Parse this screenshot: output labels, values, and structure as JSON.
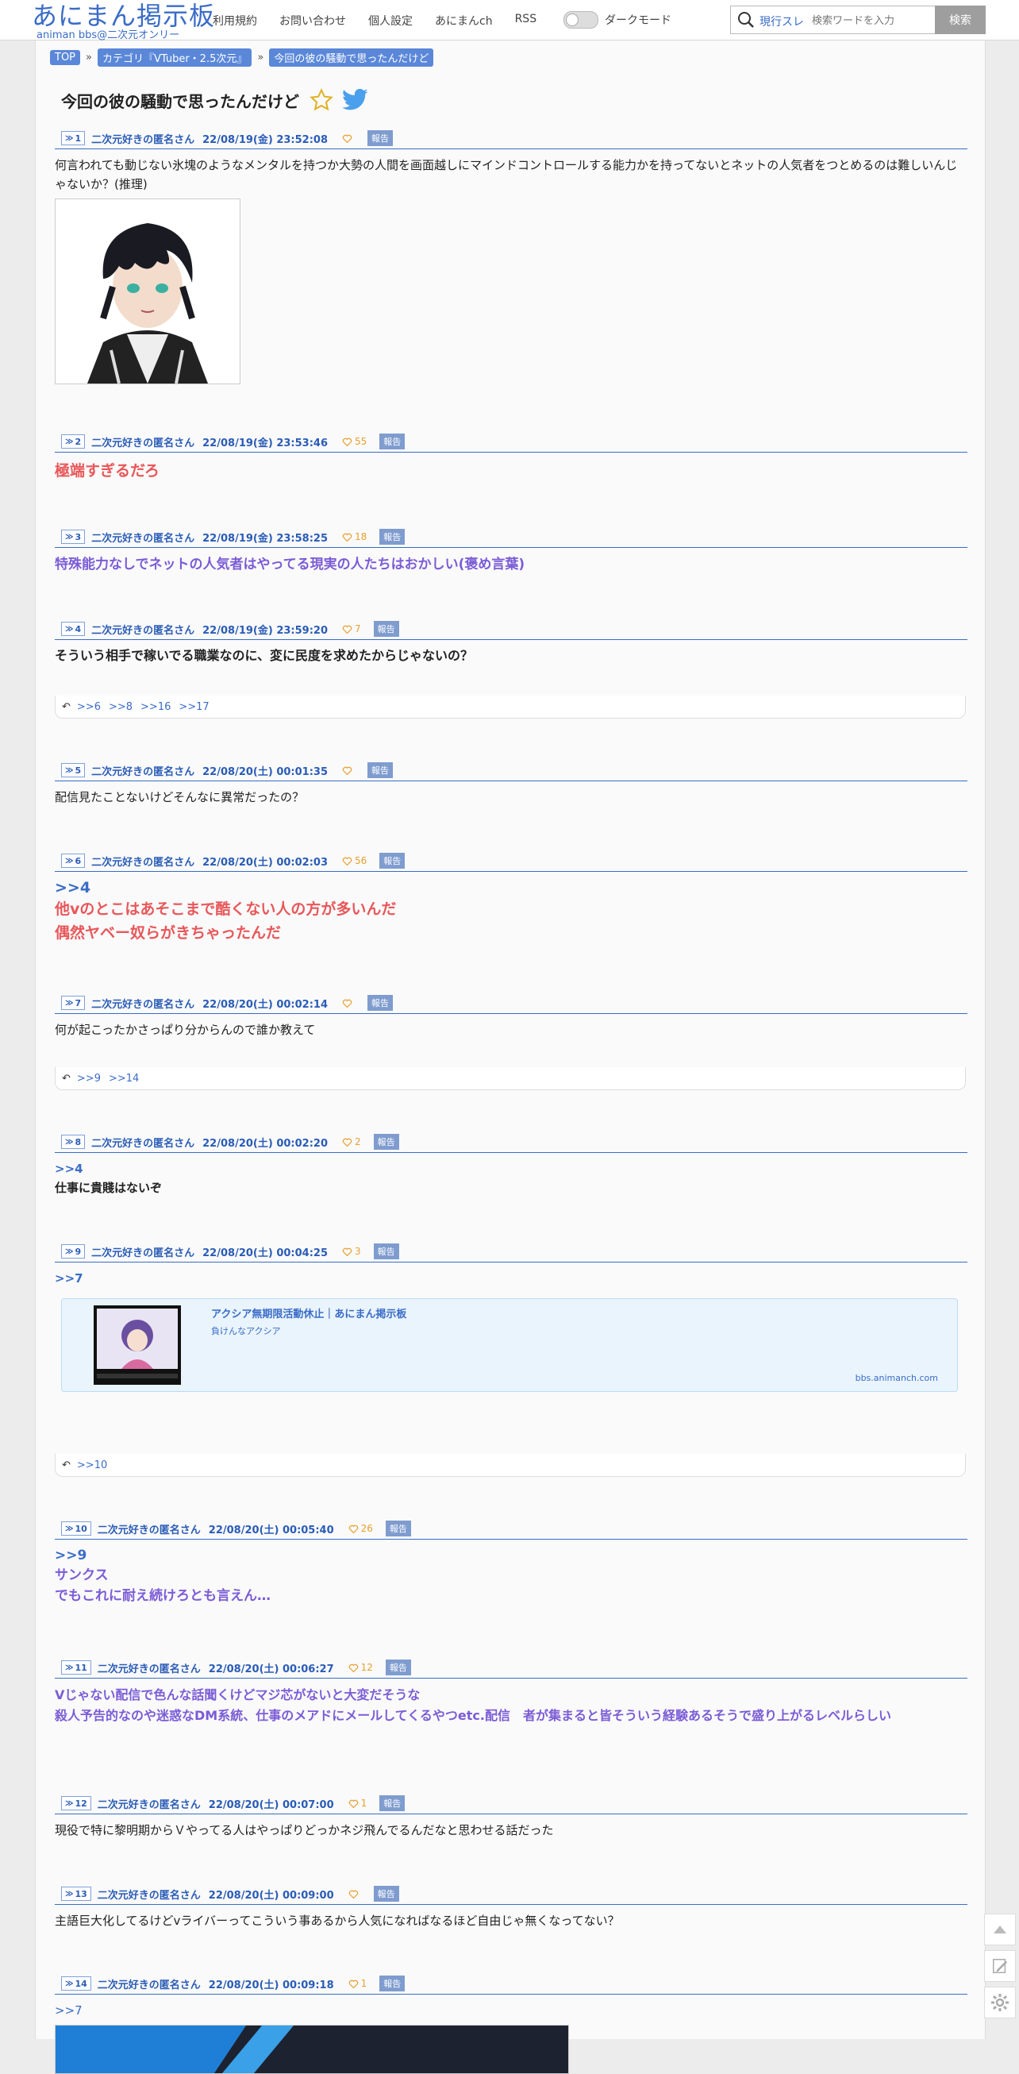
{
  "header": {
    "logo_main": "あにまん掲示板",
    "logo_sub": "animan bbs@二次元オンリー",
    "nav": [
      "利用規約",
      "お問い合わせ",
      "個人設定",
      "あにまんch",
      "RSS"
    ],
    "dark_mode_label": "ダークモード",
    "search_scope": "現行スレ",
    "search_placeholder": "検索ワードを入力",
    "search_button": "検索"
  },
  "breadcrumb": [
    "TOP",
    "カテゴリ『VTuber・2.5次元』",
    "今回の彼の騒動で思ったんだけど"
  ],
  "breadcrumb_sep": "»",
  "thread_title": "今回の彼の騒動で思ったんだけど",
  "posts": [
    {
      "num": "1",
      "name": "二次元好きの匿名さん",
      "date": "22/08/19(金) 23:52:08",
      "likes": "",
      "report": "報告",
      "text": "何言われても動じない氷塊のようなメンタルを持つか大勢の人間を画面越しにマインドコントロールする能力かを持ってないとネットの人気者をつとめるのは難しいんじゃないか？(推理)"
    },
    {
      "num": "2",
      "name": "二次元好きの匿名さん",
      "date": "22/08/19(金) 23:53:46",
      "likes": "55",
      "report": "報告",
      "text": "極端すぎるだろ"
    },
    {
      "num": "3",
      "name": "二次元好きの匿名さん",
      "date": "22/08/19(金) 23:58:25",
      "likes": "18",
      "report": "報告",
      "text": "特殊能力なしでネットの人気者はやってる現実の人たちはおかしい(褒め言葉)"
    },
    {
      "num": "4",
      "name": "二次元好きの匿名さん",
      "date": "22/08/19(金) 23:59:20",
      "likes": "7",
      "report": "報告",
      "text": "そういう相手で稼いでる職業なのに、変に民度を求めたからじゃないの？",
      "replies": [
        ">>6",
        ">>8",
        ">>16",
        ">>17"
      ]
    },
    {
      "num": "5",
      "name": "二次元好きの匿名さん",
      "date": "22/08/20(土) 00:01:35",
      "likes": "",
      "report": "報告",
      "text": "配信見たことないけどそんなに異常だったの？"
    },
    {
      "num": "6",
      "name": "二次元好きの匿名さん",
      "date": "22/08/20(土) 00:02:03",
      "likes": "56",
      "report": "報告",
      "anchor": ">>4",
      "line1": "他vのとこはあそこまで酷くない人の方が多いんだ",
      "line2": "偶然ヤベー奴らがきちゃったんだ"
    },
    {
      "num": "7",
      "name": "二次元好きの匿名さん",
      "date": "22/08/20(土) 00:02:14",
      "likes": "",
      "report": "報告",
      "text": "何が起こったかさっぱり分からんので誰か教えて",
      "replies": [
        ">>9",
        ">>14"
      ]
    },
    {
      "num": "8",
      "name": "二次元好きの匿名さん",
      "date": "22/08/20(土) 00:02:20",
      "likes": "2",
      "report": "報告",
      "anchor": ">>4",
      "text": "仕事に貴賤はないぞ"
    },
    {
      "num": "9",
      "name": "二次元好きの匿名さん",
      "date": "22/08/20(土) 00:04:25",
      "likes": "3",
      "report": "報告",
      "anchor": ">>7",
      "card_title": "アクシア無期限活動休止｜あにまん掲示板",
      "card_desc": "負けんなアクシア",
      "card_domain": "bbs.animanch.com",
      "replies": [
        ">>10"
      ]
    },
    {
      "num": "10",
      "name": "二次元好きの匿名さん",
      "date": "22/08/20(土) 00:05:40",
      "likes": "26",
      "report": "報告",
      "anchor": ">>9",
      "line1": "サンクス",
      "line2": "でもこれに耐え続けろとも言えん…"
    },
    {
      "num": "11",
      "name": "二次元好きの匿名さん",
      "date": "22/08/20(土) 00:06:27",
      "likes": "12",
      "report": "報告",
      "line1": "Vじゃない配信で色んな話聞くけどマジ芯がないと大変だそうな",
      "line2": "殺人予告的なのや迷惑なDM系統、仕事のメアドにメールしてくるやつetc.配信　者が集まると皆そういう経験あるそうで盛り上がるレベルらしい"
    },
    {
      "num": "12",
      "name": "二次元好きの匿名さん",
      "date": "22/08/20(土) 00:07:00",
      "likes": "1",
      "report": "報告",
      "text": "現役で特に黎明期からＶやってる人はやっぱりどっかネジ飛んでるんだなと思わせる話だった"
    },
    {
      "num": "13",
      "name": "二次元好きの匿名さん",
      "date": "22/08/20(土) 00:09:00",
      "likes": "",
      "report": "報告",
      "text": "主語巨大化してるけどvライバーってこういう事あるから人気になればなるほど自由じゃ無くなってない？"
    },
    {
      "num": "14",
      "name": "二次元好きの匿名さん",
      "date": "22/08/20(土) 00:09:18",
      "likes": "1",
      "report": "報告",
      "anchor": ">>7"
    }
  ],
  "colors": {
    "accent": "#3a6cc7",
    "red_text": "#e8575a",
    "purple_text": "#7b5cd6",
    "like": "#e8a030"
  }
}
